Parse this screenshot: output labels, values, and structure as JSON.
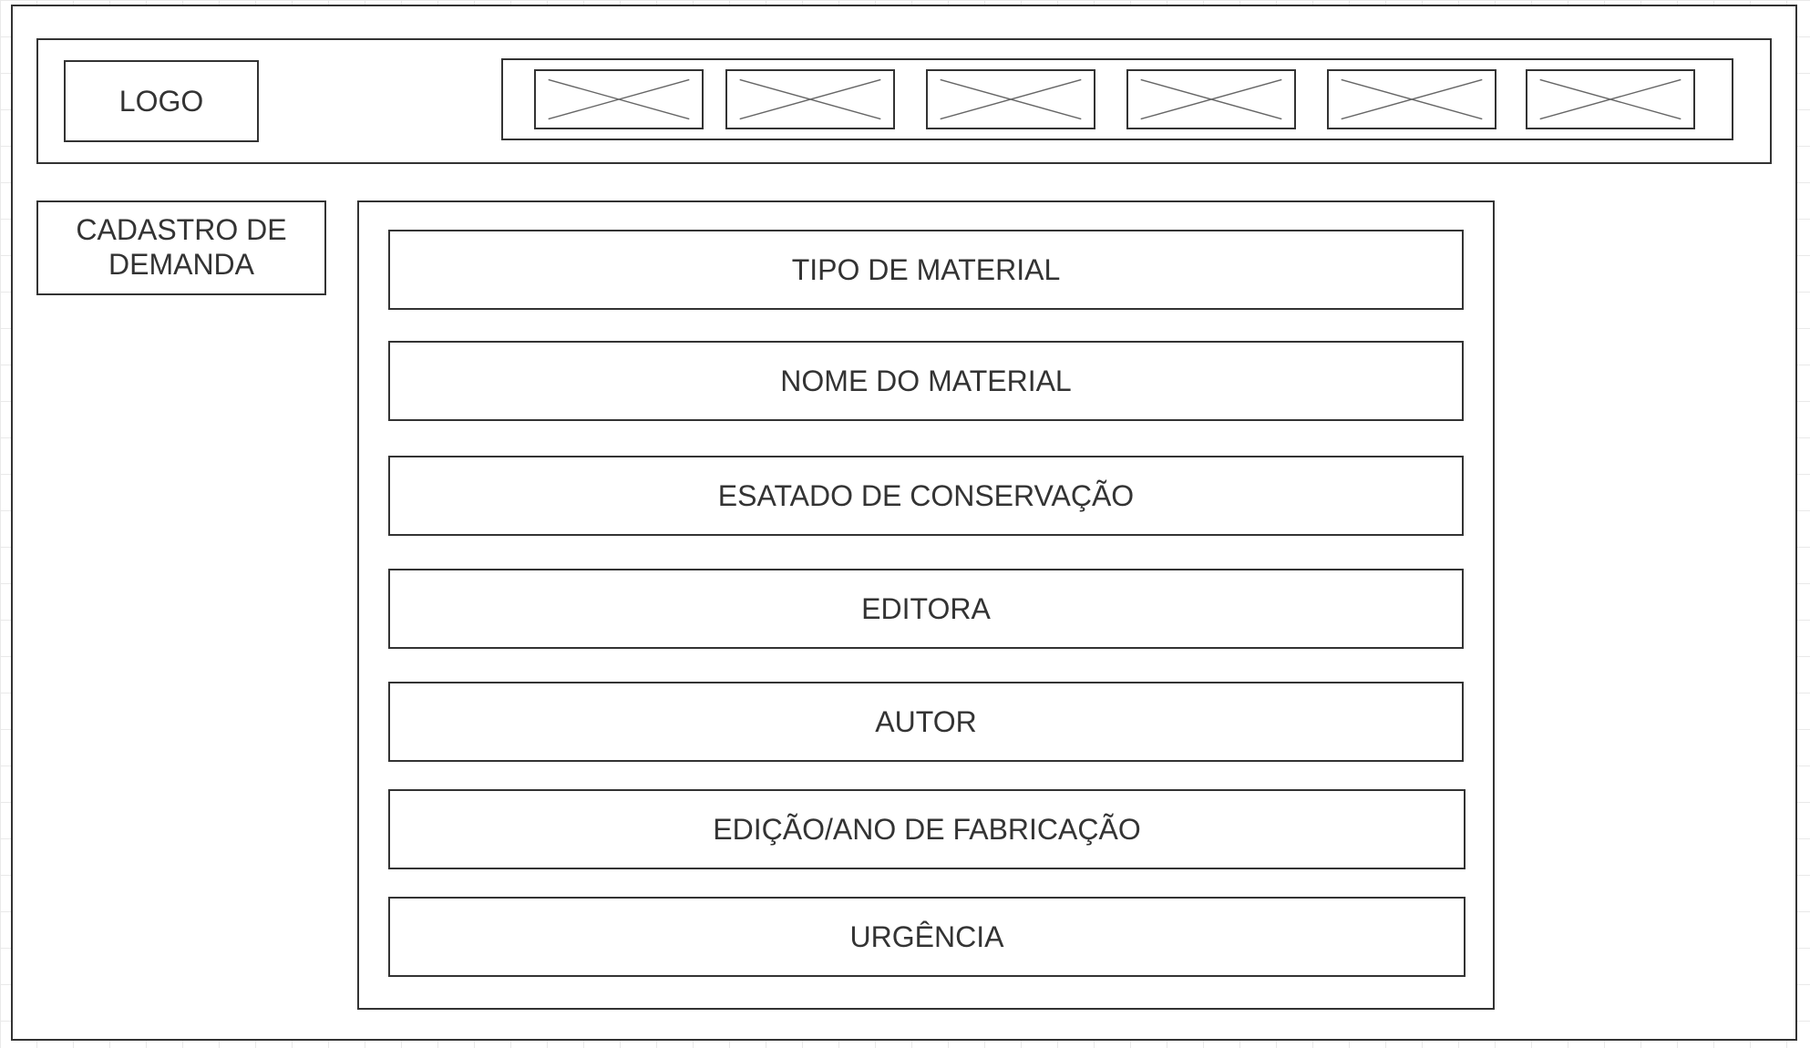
{
  "header": {
    "logo_label": "LOGO",
    "nav_items": [
      {
        "icon": "image-placeholder-icon"
      },
      {
        "icon": "image-placeholder-icon"
      },
      {
        "icon": "image-placeholder-icon"
      },
      {
        "icon": "image-placeholder-icon"
      },
      {
        "icon": "image-placeholder-icon"
      },
      {
        "icon": "image-placeholder-icon"
      }
    ]
  },
  "sidebar": {
    "title_line1": "CADASTRO DE",
    "title_line2": "DEMANDA"
  },
  "form": {
    "fields": [
      {
        "label": "TIPO DE MATERIAL"
      },
      {
        "label": "NOME DO MATERIAL"
      },
      {
        "label": "ESATADO DE CONSERVAÇÃO"
      },
      {
        "label": "EDITORA"
      },
      {
        "label": "AUTOR"
      },
      {
        "label": "EDIÇÃO/ANO DE FABRICAÇÃO"
      },
      {
        "label": "URGÊNCIA"
      }
    ]
  },
  "colors": {
    "stroke": "#333333",
    "placeholder_cross": "#666666",
    "grid": "#e9e9e9",
    "background": "#ffffff"
  }
}
